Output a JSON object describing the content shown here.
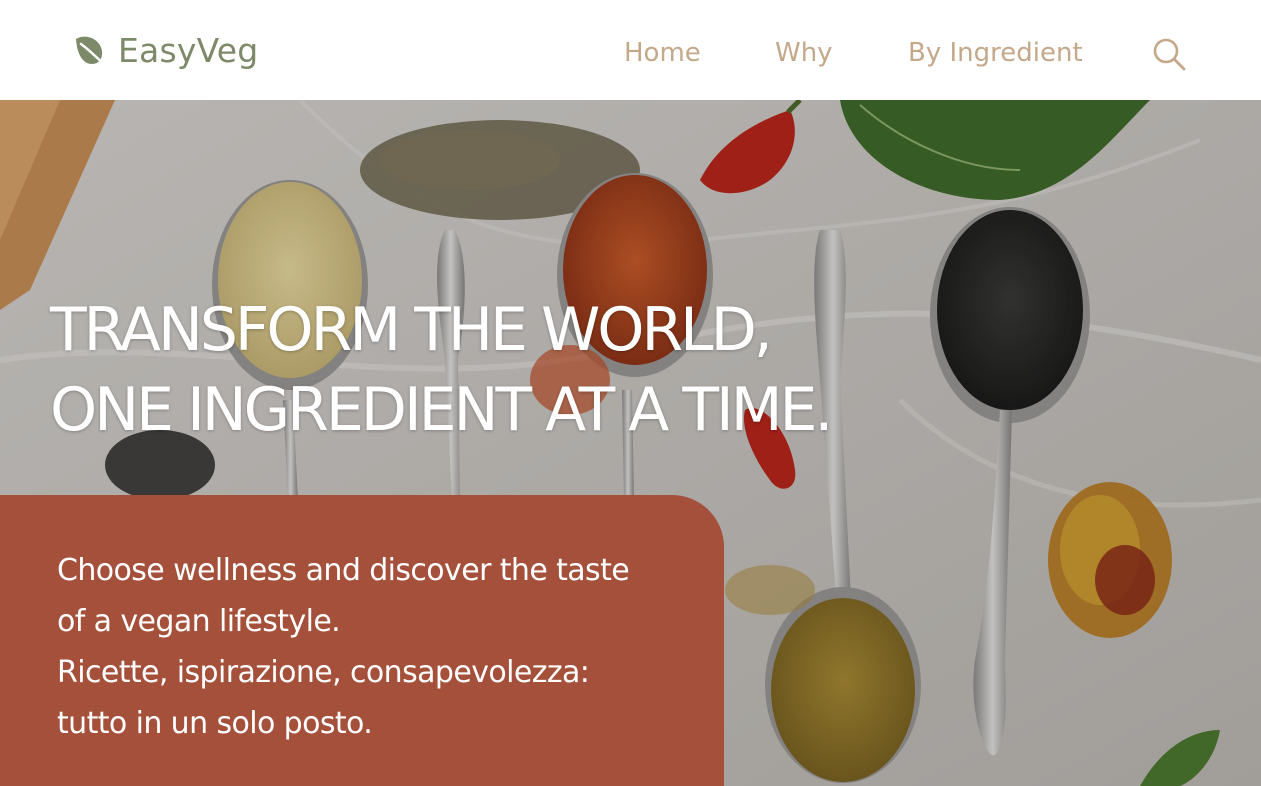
{
  "brand": {
    "name": "EasyVeg",
    "logo_icon": "leaf-icon",
    "color": "#7d8a6a"
  },
  "nav": {
    "items": [
      {
        "label": "Home"
      },
      {
        "label": "Why"
      },
      {
        "label": "By Ingredient"
      }
    ],
    "search_icon": "search-icon",
    "color": "#c4a88a"
  },
  "hero": {
    "title_line1": "TRANSFORM THE WORLD,",
    "title_line2": "ONE INGREDIENT AT A TIME.",
    "image": "spices-on-spoons-photo"
  },
  "card": {
    "line1": "Choose wellness and discover the taste",
    "line2": "of a vegan lifestyle.",
    "line3": "Ricette, ispirazione, consapevolezza:",
    "line4": "tutto in un solo posto.",
    "color": "#a4503a"
  }
}
